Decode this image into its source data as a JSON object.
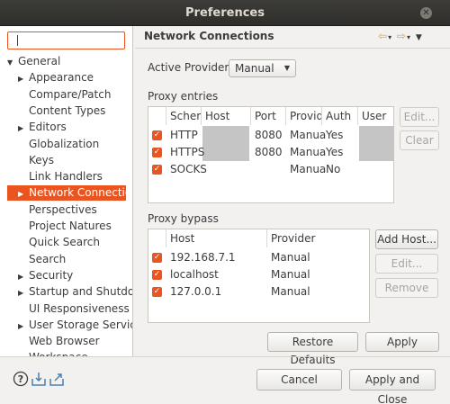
{
  "window": {
    "title": "Preferences"
  },
  "filter": {
    "value": ""
  },
  "tree": [
    {
      "label": "General",
      "expander": "open",
      "indent": 0,
      "selected": false
    },
    {
      "label": "Appearance",
      "expander": "closed",
      "indent": 1,
      "selected": false
    },
    {
      "label": "Compare/Patch",
      "expander": "none",
      "indent": 1,
      "selected": false
    },
    {
      "label": "Content Types",
      "expander": "none",
      "indent": 1,
      "selected": false
    },
    {
      "label": "Editors",
      "expander": "closed",
      "indent": 1,
      "selected": false
    },
    {
      "label": "Globalization",
      "expander": "none",
      "indent": 1,
      "selected": false
    },
    {
      "label": "Keys",
      "expander": "none",
      "indent": 1,
      "selected": false
    },
    {
      "label": "Link Handlers",
      "expander": "none",
      "indent": 1,
      "selected": false
    },
    {
      "label": "Network Connection",
      "expander": "closed",
      "indent": 1,
      "selected": true
    },
    {
      "label": "Perspectives",
      "expander": "none",
      "indent": 1,
      "selected": false
    },
    {
      "label": "Project Natures",
      "expander": "none",
      "indent": 1,
      "selected": false
    },
    {
      "label": "Quick Search",
      "expander": "none",
      "indent": 1,
      "selected": false
    },
    {
      "label": "Search",
      "expander": "none",
      "indent": 1,
      "selected": false
    },
    {
      "label": "Security",
      "expander": "closed",
      "indent": 1,
      "selected": false
    },
    {
      "label": "Startup and Shutdo",
      "expander": "closed",
      "indent": 1,
      "selected": false
    },
    {
      "label": "UI Responsiveness M",
      "expander": "none",
      "indent": 1,
      "selected": false
    },
    {
      "label": "User Storage Service",
      "expander": "closed",
      "indent": 1,
      "selected": false
    },
    {
      "label": "Web Browser",
      "expander": "none",
      "indent": 1,
      "selected": false
    },
    {
      "label": "Workspace",
      "expander": "closed",
      "indent": 1,
      "selected": false
    }
  ],
  "page": {
    "title": "Network Connections",
    "active_provider_label": "Active Provider:",
    "active_provider_value": "Manual",
    "proxy_entries_label": "Proxy entries",
    "proxy_bypass_label": "Proxy bypass"
  },
  "proxy_entries": {
    "columns": [
      "Schem",
      "Host",
      "Port",
      "Provid",
      "Auth",
      "User"
    ],
    "rows": [
      {
        "checked": true,
        "scheme": "HTTP",
        "host": "",
        "port": "8080",
        "provider": "Manua",
        "auth": "Yes",
        "user": ""
      },
      {
        "checked": true,
        "scheme": "HTTPS",
        "host": "",
        "port": "8080",
        "provider": "Manua",
        "auth": "Yes",
        "user": ""
      },
      {
        "checked": true,
        "scheme": "SOCKS",
        "host": "",
        "port": "",
        "provider": "Manua",
        "auth": "No",
        "user": ""
      }
    ],
    "buttons": {
      "edit": "Edit...",
      "clear": "Clear"
    }
  },
  "proxy_bypass": {
    "columns": [
      "Host",
      "Provider"
    ],
    "rows": [
      {
        "checked": true,
        "host": "192.168.7.1",
        "provider": "Manual"
      },
      {
        "checked": true,
        "host": "localhost",
        "provider": "Manual"
      },
      {
        "checked": true,
        "host": "127.0.0.1",
        "provider": "Manual"
      }
    ],
    "buttons": {
      "add_host": "Add Host...",
      "edit": "Edit...",
      "remove": "Remove"
    }
  },
  "actions": {
    "restore_defaults": "Restore Defaults",
    "apply": "Apply",
    "cancel": "Cancel",
    "apply_and_close": "Apply and Close"
  },
  "icons": {
    "help": "help-icon",
    "import": "import-icon",
    "export": "export-icon",
    "back": "back-arrow-icon",
    "forward": "forward-arrow-icon",
    "menu": "view-menu-icon"
  },
  "colors": {
    "accent": "#e95420",
    "titlebar": "#3d3c38",
    "nav_arrow": "#e0a23a"
  }
}
